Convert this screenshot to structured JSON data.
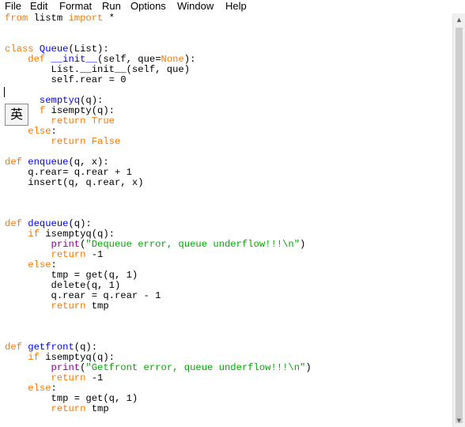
{
  "menubar": {
    "file": "File",
    "edit": "Edit",
    "format": "Format",
    "run": "Run",
    "options": "Options",
    "window": "Window",
    "help": "Help"
  },
  "ime": {
    "label": "英"
  },
  "scrollbar": {
    "up_glyph": "▲",
    "down_glyph": "▼"
  },
  "code_lines": [
    [
      [
        "kw",
        "from"
      ],
      [
        "",
        " listm "
      ],
      [
        "kw",
        "import"
      ],
      [
        "",
        " *"
      ]
    ],
    [],
    [],
    [
      [
        "kw",
        "class"
      ],
      [
        "",
        " "
      ],
      [
        "def",
        "Queue"
      ],
      [
        "",
        "(List):"
      ]
    ],
    [
      [
        "",
        "    "
      ],
      [
        "kw",
        "def"
      ],
      [
        "",
        " "
      ],
      [
        "def",
        "__init__"
      ],
      [
        "",
        "(self, que="
      ],
      [
        "kw",
        "None"
      ],
      [
        "",
        "):"
      ]
    ],
    [
      [
        "",
        "        List.__init__(self, que)"
      ]
    ],
    [
      [
        "",
        "        self.rear = 0"
      ]
    ],
    [],
    [
      [
        "",
        "      "
      ],
      [
        "def",
        "semptyq"
      ],
      [
        "",
        "(q):"
      ]
    ],
    [
      [
        "",
        "      "
      ],
      [
        "kw",
        "f"
      ],
      [
        "",
        " isempty(q):"
      ]
    ],
    [
      [
        "",
        "        "
      ],
      [
        "kw",
        "return"
      ],
      [
        "",
        " "
      ],
      [
        "kw",
        "True"
      ]
    ],
    [
      [
        "",
        "    "
      ],
      [
        "kw",
        "else"
      ],
      [
        "",
        ":"
      ]
    ],
    [
      [
        "",
        "        "
      ],
      [
        "kw",
        "return"
      ],
      [
        "",
        " "
      ],
      [
        "kw",
        "False"
      ]
    ],
    [],
    [
      [
        "kw",
        "def"
      ],
      [
        "",
        " "
      ],
      [
        "def",
        "enqueue"
      ],
      [
        "",
        "(q, x):"
      ]
    ],
    [
      [
        "",
        "    q.rear= q.rear + 1"
      ]
    ],
    [
      [
        "",
        "    insert(q, q.rear, x)"
      ]
    ],
    [],
    [],
    [],
    [
      [
        "kw",
        "def"
      ],
      [
        "",
        " "
      ],
      [
        "def",
        "dequeue"
      ],
      [
        "",
        "(q):"
      ]
    ],
    [
      [
        "",
        "    "
      ],
      [
        "kw",
        "if"
      ],
      [
        "",
        " isemptyq(q):"
      ]
    ],
    [
      [
        "",
        "        "
      ],
      [
        "bi",
        "print"
      ],
      [
        "",
        "("
      ],
      [
        "str",
        "\"Dequeue error, queue underflow!!!\\n\""
      ],
      [
        "",
        ")"
      ]
    ],
    [
      [
        "",
        "        "
      ],
      [
        "kw",
        "return"
      ],
      [
        "",
        " -1"
      ]
    ],
    [
      [
        "",
        "    "
      ],
      [
        "kw",
        "else"
      ],
      [
        "",
        ":"
      ]
    ],
    [
      [
        "",
        "        tmp = get(q, 1)"
      ]
    ],
    [
      [
        "",
        "        delete(q, 1)"
      ]
    ],
    [
      [
        "",
        "        q.rear = q.rear - 1"
      ]
    ],
    [
      [
        "",
        "        "
      ],
      [
        "kw",
        "return"
      ],
      [
        "",
        " tmp"
      ]
    ],
    [],
    [],
    [],
    [
      [
        "kw",
        "def"
      ],
      [
        "",
        " "
      ],
      [
        "def",
        "getfront"
      ],
      [
        "",
        "(q):"
      ]
    ],
    [
      [
        "",
        "    "
      ],
      [
        "kw",
        "if"
      ],
      [
        "",
        " isemptyq(q):"
      ]
    ],
    [
      [
        "",
        "        "
      ],
      [
        "bi",
        "print"
      ],
      [
        "",
        "("
      ],
      [
        "str",
        "\"Getfront error, queue underflow!!!\\n\""
      ],
      [
        "",
        ")"
      ]
    ],
    [
      [
        "",
        "        "
      ],
      [
        "kw",
        "return"
      ],
      [
        "",
        " -1"
      ]
    ],
    [
      [
        "",
        "    "
      ],
      [
        "kw",
        "else"
      ],
      [
        "",
        ":"
      ]
    ],
    [
      [
        "",
        "        tmp = get(q, 1)"
      ]
    ],
    [
      [
        "",
        "        "
      ],
      [
        "kw",
        "return"
      ],
      [
        "",
        " tmp"
      ]
    ]
  ],
  "colors": {
    "keyword": "#ff7700",
    "definition": "#0000ff",
    "builtin": "#900090",
    "string": "#00aa00",
    "text": "#000000",
    "background": "#ffffff"
  }
}
